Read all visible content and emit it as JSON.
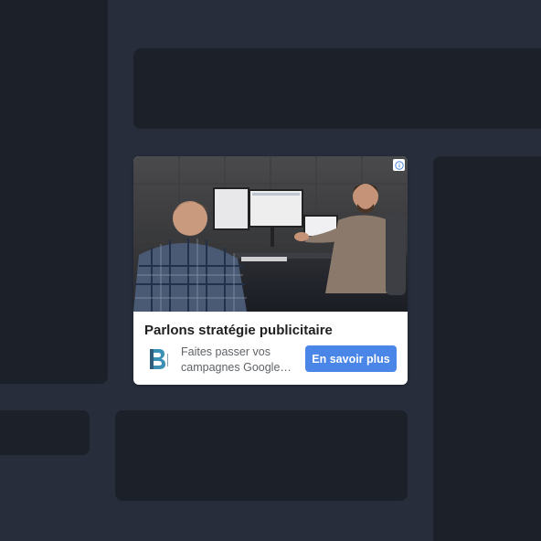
{
  "ad": {
    "headline": "Parlons stratégie publicitaire",
    "description_line1": "Faites passer vos",
    "description_line2": "campagnes Google…",
    "cta_label": "En savoir plus",
    "logo_letter": "B",
    "choices_icon": "info-icon",
    "accent_color": "#4a86e8"
  }
}
